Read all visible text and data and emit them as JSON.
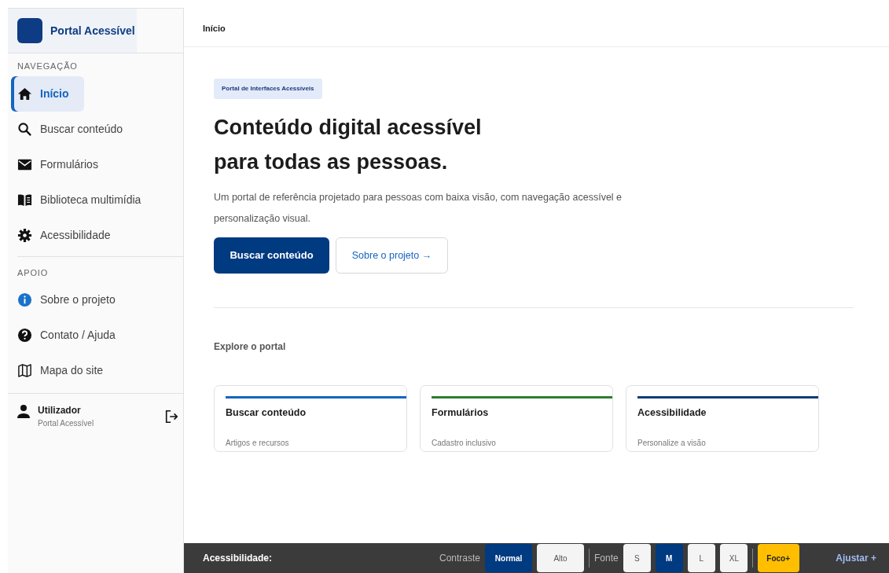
{
  "brand": {
    "name": "Portal Acessível"
  },
  "sidebar": {
    "sections": [
      {
        "title": "NAVEGAÇÃO",
        "items": [
          {
            "label": "Início",
            "kind": "home",
            "selected": true
          },
          {
            "label": "Buscar conteúdo",
            "kind": "search",
            "selected": false
          },
          {
            "label": "Formulários",
            "kind": "mail",
            "selected": false
          },
          {
            "label": "Biblioteca multimídia",
            "kind": "book",
            "selected": false
          },
          {
            "label": "Acessibilidade",
            "kind": "gear",
            "selected": false
          }
        ]
      },
      {
        "title": "APOIO",
        "items": [
          {
            "label": "Sobre o projeto",
            "kind": "info",
            "selected": false
          },
          {
            "label": "Contato / Ajuda",
            "kind": "help",
            "selected": false
          },
          {
            "label": "Mapa do site",
            "kind": "map",
            "selected": false
          }
        ]
      }
    ],
    "user": {
      "name": "Utilizador",
      "subtitle": "Portal Acessível"
    }
  },
  "breadcrumb": "Início",
  "hero": {
    "tag": "Portal de Interfaces Acessíveis",
    "title_lines": [
      "Conteúdo digital acessível",
      "para todas as pessoas."
    ],
    "description": "Um portal de referência projetado para pessoas com baixa visão, com navegação acessível e personalização visual.",
    "buttons": [
      {
        "label": "Buscar conteúdo",
        "kind": "primary"
      },
      {
        "label": "Sobre o projeto →",
        "kind": "outline"
      }
    ]
  },
  "explore": {
    "title": "Explore o portal",
    "cards": [
      {
        "title": "Buscar conteúdo",
        "subtitle": "Artigos e recursos",
        "color": "#1565c0"
      },
      {
        "title": "Formulários",
        "subtitle": "Cadastro inclusivo",
        "color": "#2e7d32"
      },
      {
        "title": "Acessibilidade",
        "subtitle": "Personalize a visão",
        "color": "#0d3c7a"
      }
    ]
  },
  "accessibility_bar": {
    "title": "Acessibilidade:",
    "groups": [
      {
        "label": "Contraste",
        "options": [
          {
            "label": "Normal",
            "selected": true
          },
          {
            "label": "Alto",
            "selected": false
          }
        ]
      },
      {
        "label": "Fonte",
        "options": [
          {
            "label": "S",
            "selected": false
          },
          {
            "label": "M",
            "selected": true
          },
          {
            "label": "L",
            "selected": false
          },
          {
            "label": "XL",
            "selected": false
          }
        ]
      }
    ],
    "focus": {
      "label": "Foco+",
      "on": true
    },
    "adjust": "Ajustar +"
  }
}
